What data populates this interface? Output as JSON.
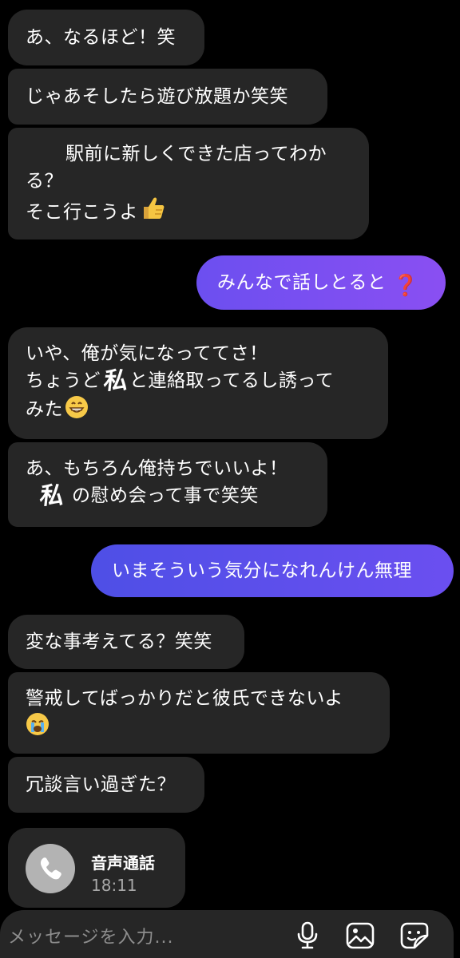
{
  "messages": [
    {
      "id": "m1",
      "lines": [
        "あ、なるほど！笑"
      ]
    },
    {
      "id": "m2",
      "lines": [
        "じゃあそしたら遊び放題か笑笑"
      ]
    },
    {
      "id": "m3",
      "lines": [
        "駅前に新しくできた店ってわか",
        "る？",
        "そこ行こうよ"
      ]
    },
    {
      "id": "m4",
      "lines": [
        "みんなで話しとると"
      ],
      "emoji": "❓"
    },
    {
      "id": "m5",
      "lines": [
        "いや、俺が気になっててさ！",
        "ちょうど",
        "と連絡取ってるし誘って",
        "みた"
      ],
      "handwritten": "私"
    },
    {
      "id": "m6",
      "lines": [
        "あ、もちろん俺持ちでいいよ！",
        "の慰め会って事で笑笑"
      ],
      "handwritten": "私"
    },
    {
      "id": "m7",
      "lines": [
        "いまそういう気分になれんけん無理"
      ]
    },
    {
      "id": "m8",
      "lines": [
        "変な事考えてる？笑笑"
      ]
    },
    {
      "id": "m9",
      "lines": [
        "警戒してばっかりだと彼氏できないよ"
      ]
    },
    {
      "id": "m10",
      "lines": [
        "冗談言い過ぎた？"
      ]
    }
  ],
  "emojis": {
    "thumbs_up": "thumbs-up",
    "grin": "grinning-face",
    "cry": "crying-face"
  },
  "call": {
    "title": "音声通話",
    "time": "18:11",
    "icon": "phone-icon"
  },
  "composer": {
    "placeholder": "メッセージを入力...",
    "icons": [
      "microphone-icon",
      "image-icon",
      "sticker-icon"
    ]
  },
  "colors": {
    "background": "#000000",
    "incoming_bubble": "#262626",
    "outgoing_gradient_start": "#5b4fe8",
    "outgoing_gradient_end": "#8c4ff0"
  }
}
